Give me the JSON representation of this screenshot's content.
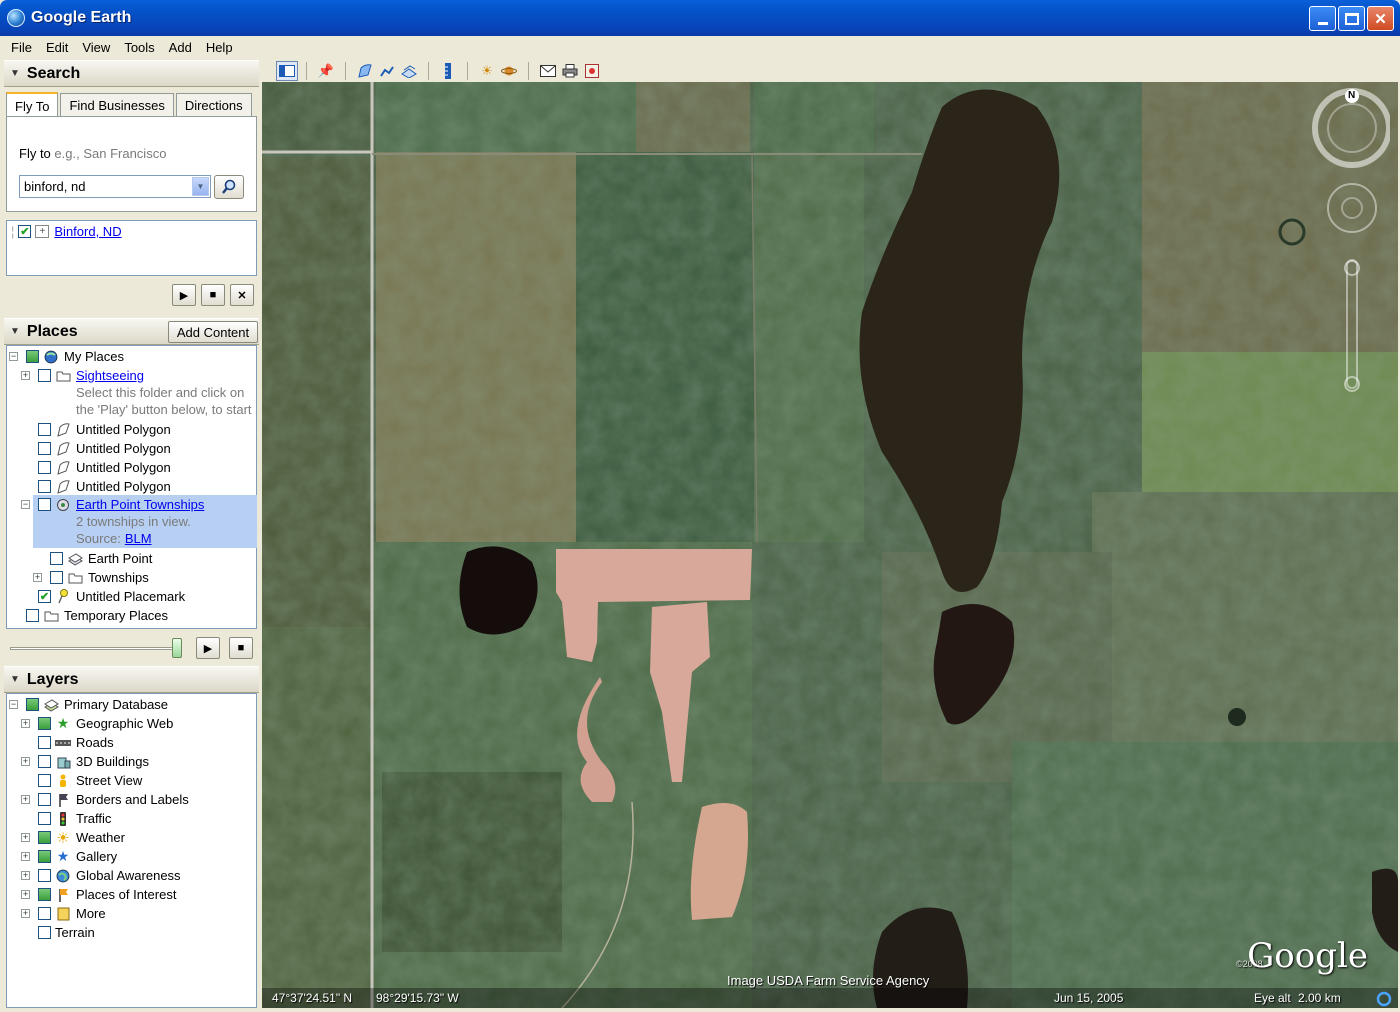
{
  "window": {
    "title": "Google Earth"
  },
  "menu": [
    "File",
    "Edit",
    "View",
    "Tools",
    "Add",
    "Help"
  ],
  "search": {
    "header": "Search",
    "tabs": [
      "Fly To",
      "Find Businesses",
      "Directions"
    ],
    "fly_to_label": "Fly to",
    "fly_to_hint": "e.g., San Francisco",
    "query": "binford, nd",
    "result": "Binford, ND"
  },
  "places": {
    "header": "Places",
    "add_content": "Add Content",
    "items": {
      "my_places": "My Places",
      "sightseeing": "Sightseeing",
      "sightseeing_desc1": "Select this folder and click on",
      "sightseeing_desc2": "the 'Play' button below, to start",
      "polygon": "Untitled Polygon",
      "ept": "Earth Point Townships",
      "ept_desc": "2 townships in view.",
      "ept_source_label": "Source:",
      "ept_source_link": "BLM",
      "earth_point": "Earth Point",
      "townships": "Townships",
      "placemark": "Untitled Placemark",
      "temporary": "Temporary Places"
    }
  },
  "layers": {
    "header": "Layers",
    "items": [
      "Primary Database",
      "Geographic Web",
      "Roads",
      "3D Buildings",
      "Street View",
      "Borders and Labels",
      "Traffic",
      "Weather",
      "Gallery",
      "Global Awareness",
      "Places of Interest",
      "More",
      "Terrain"
    ]
  },
  "map": {
    "attribution": "Image USDA Farm Service Agency",
    "copyright": "©2008",
    "logo": "Google",
    "lat": "47°37'24.51\" N",
    "lon": "98°29'15.73\" W",
    "date": "Jun 15, 2005",
    "eye_alt_label": "Eye alt",
    "eye_alt_value": "2.00 km",
    "compass_n": "N"
  }
}
